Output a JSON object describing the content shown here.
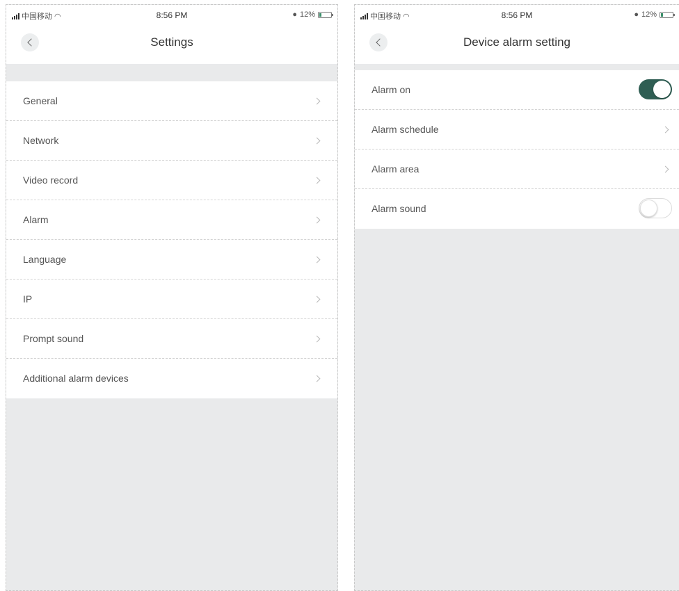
{
  "colors": {
    "accent": "#2f5e53",
    "background": "#e9eaeb"
  },
  "left_screen": {
    "status": {
      "carrier": "中国移动",
      "time": "8:56 PM",
      "battery": "12%"
    },
    "title": "Settings",
    "items": [
      {
        "label": "General",
        "icon": "chevron-right-icon"
      },
      {
        "label": "Network",
        "icon": "chevron-right-icon"
      },
      {
        "label": "Video record",
        "icon": "chevron-right-icon"
      },
      {
        "label": "Alarm",
        "icon": "chevron-right-icon"
      },
      {
        "label": "Language",
        "icon": "chevron-right-icon"
      },
      {
        "label": "IP",
        "icon": "chevron-right-icon"
      },
      {
        "label": "Prompt sound",
        "icon": "chevron-right-icon"
      },
      {
        "label": "Additional alarm devices",
        "icon": "chevron-right-icon"
      }
    ]
  },
  "right_screen": {
    "status": {
      "carrier": "中国移动",
      "time": "8:56 PM",
      "battery": "12%"
    },
    "title": "Device alarm setting",
    "items": [
      {
        "label": "Alarm on",
        "control": "toggle",
        "value": true
      },
      {
        "label": "Alarm schedule",
        "control": "chevron"
      },
      {
        "label": "Alarm area",
        "control": "chevron"
      },
      {
        "label": "Alarm sound",
        "control": "toggle",
        "value": false
      }
    ]
  }
}
